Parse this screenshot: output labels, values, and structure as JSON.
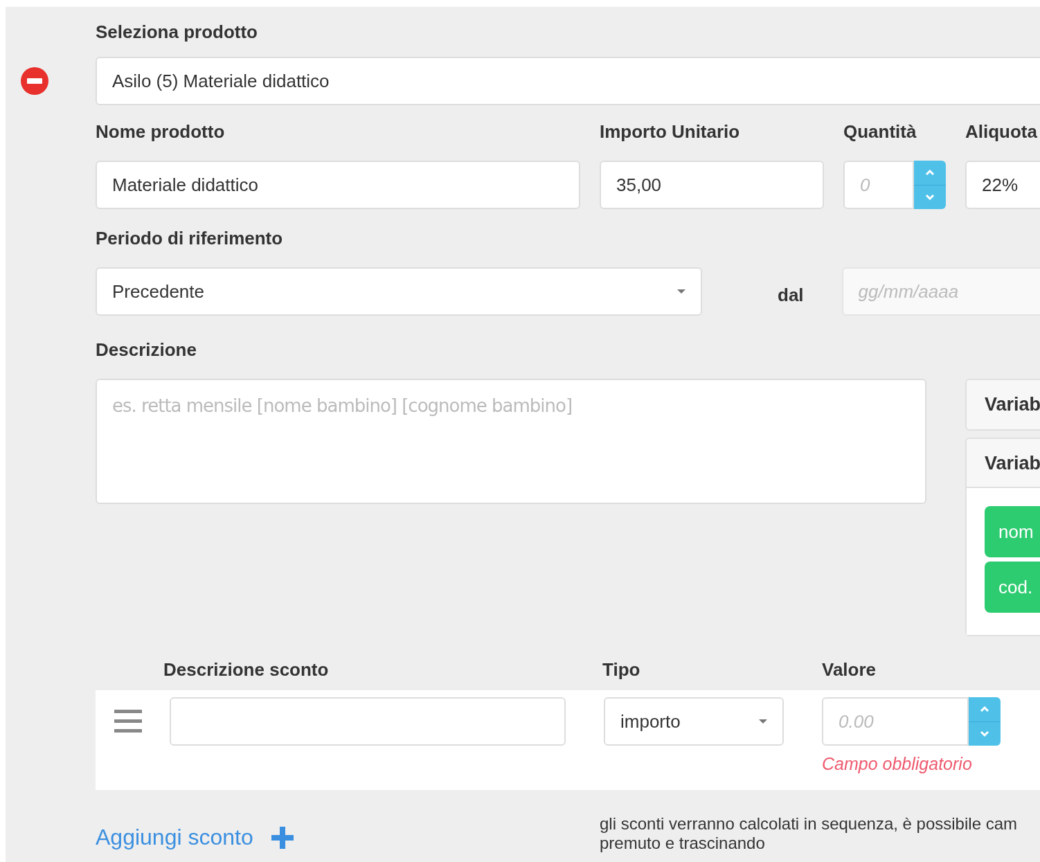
{
  "product_select": {
    "label": "Seleziona prodotto",
    "value": "Asilo (5) Materiale didattico"
  },
  "fields": [
    {
      "label": "Nome prodotto",
      "value": "Materiale didattico",
      "kind": "text"
    },
    {
      "label": "Importo Unitario",
      "value": "35,00",
      "kind": "text"
    },
    {
      "label": "Quantità",
      "placeholder": "0",
      "kind": "spinner"
    },
    {
      "label": "Aliquota",
      "value": "22%",
      "kind": "text"
    }
  ],
  "period": {
    "label": "Periodo di riferimento",
    "value": "Precedente",
    "from_label": "dal",
    "from_placeholder": "gg/mm/aaaa"
  },
  "description": {
    "label": "Descrizione",
    "placeholder": "es. retta mensile [nome bambino] [cognome bambino]"
  },
  "variable_panels": [
    {
      "title": "Variab",
      "expanded": false
    },
    {
      "title": "Variab",
      "expanded": true,
      "tags": [
        "nom",
        "cod."
      ]
    }
  ],
  "discounts": {
    "columns": [
      "Descrizione sconto",
      "Tipo",
      "Valore"
    ],
    "rows": [
      {
        "type": "importo",
        "value_placeholder": "0.00",
        "error": "Campo obbligatorio"
      }
    ]
  },
  "add_discount": "Aggiungi sconto",
  "note": "gli sconti verranno calcolati in sequenza, è possibile cam\npremuto e trascinando"
}
